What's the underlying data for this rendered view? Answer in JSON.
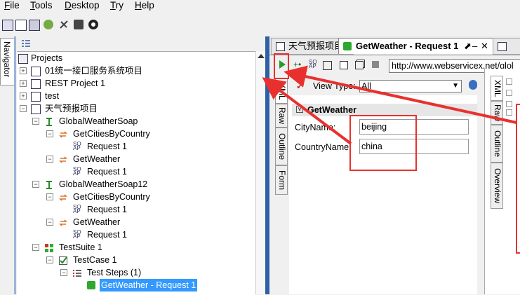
{
  "menu": [
    "File",
    "Tools",
    "Desktop",
    "Try",
    "Help"
  ],
  "navigator": {
    "tab_label": "Navigator"
  },
  "tree": {
    "root": "Projects",
    "items": [
      "01统一接口服务系统项目",
      "REST Project 1",
      "test",
      "天气预报项目",
      "GlobalWeatherSoap",
      "GetCitiesByCountry",
      "Request 1",
      "GetWeather",
      "Request 1",
      "GlobalWeatherSoap12",
      "GetCitiesByCountry",
      "Request 1",
      "GetWeather",
      "Request 1",
      "TestSuite 1",
      "TestCase 1",
      "Test Steps (1)",
      "GetWeather - Request 1"
    ]
  },
  "editor": {
    "tabs": [
      "天气预报项目",
      "GetWeather - Request 1"
    ],
    "url": "http://www.webservicex.net/glol",
    "side_tabs": [
      "XML",
      "Raw",
      "Outline",
      "Form"
    ],
    "view_type_label": "View Type:",
    "view_type_value": "All",
    "operation": "GetWeather",
    "fields": [
      {
        "label": "CityName:",
        "value": "beijing"
      },
      {
        "label": "CountryName:",
        "value": "china"
      }
    ]
  },
  "right_panel": {
    "side_tabs": [
      "XML",
      "Raw",
      "Outline",
      "Overview"
    ]
  },
  "colors": {
    "annotation_red": "#e8312f",
    "selection_blue": "#3399ff",
    "splitter_blue": "#2f5fa8"
  }
}
